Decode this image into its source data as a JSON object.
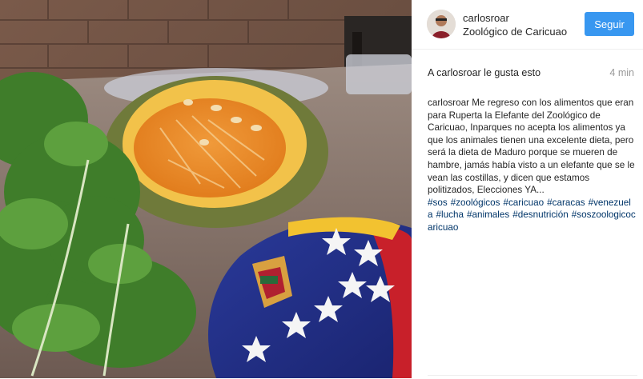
{
  "header": {
    "username": "carlosroar",
    "location": "Zoológico de Caricuao",
    "follow_label": "Seguir"
  },
  "likes": {
    "text": "A carlosroar le gusta esto",
    "time": "4 min"
  },
  "caption": {
    "username": "carlosroar",
    "text": " Me regreso con los alimentos que eran para Ruperta la Elefante del Zoológico de Caricuao, Inparques no acepta los alimentos ya que los animales tienen una excelente dieta, pero será la dieta de Maduro porque se mueren de hambre, jamás había visto a un elefante que se le vean las costillas, y dicen que estamos politizados, Elecciones YA...",
    "hashtags": [
      "#sos",
      "#zoológicos",
      "#caricuao",
      "#caracas",
      "#venezuela",
      "#lucha",
      "#animales",
      "#desnutrición",
      "#soszoologicocaricuao"
    ]
  },
  "icons": {
    "avatar": "user-avatar-photo"
  },
  "colors": {
    "accent": "#3897f0",
    "hashtag": "#003569",
    "muted": "#999999"
  }
}
